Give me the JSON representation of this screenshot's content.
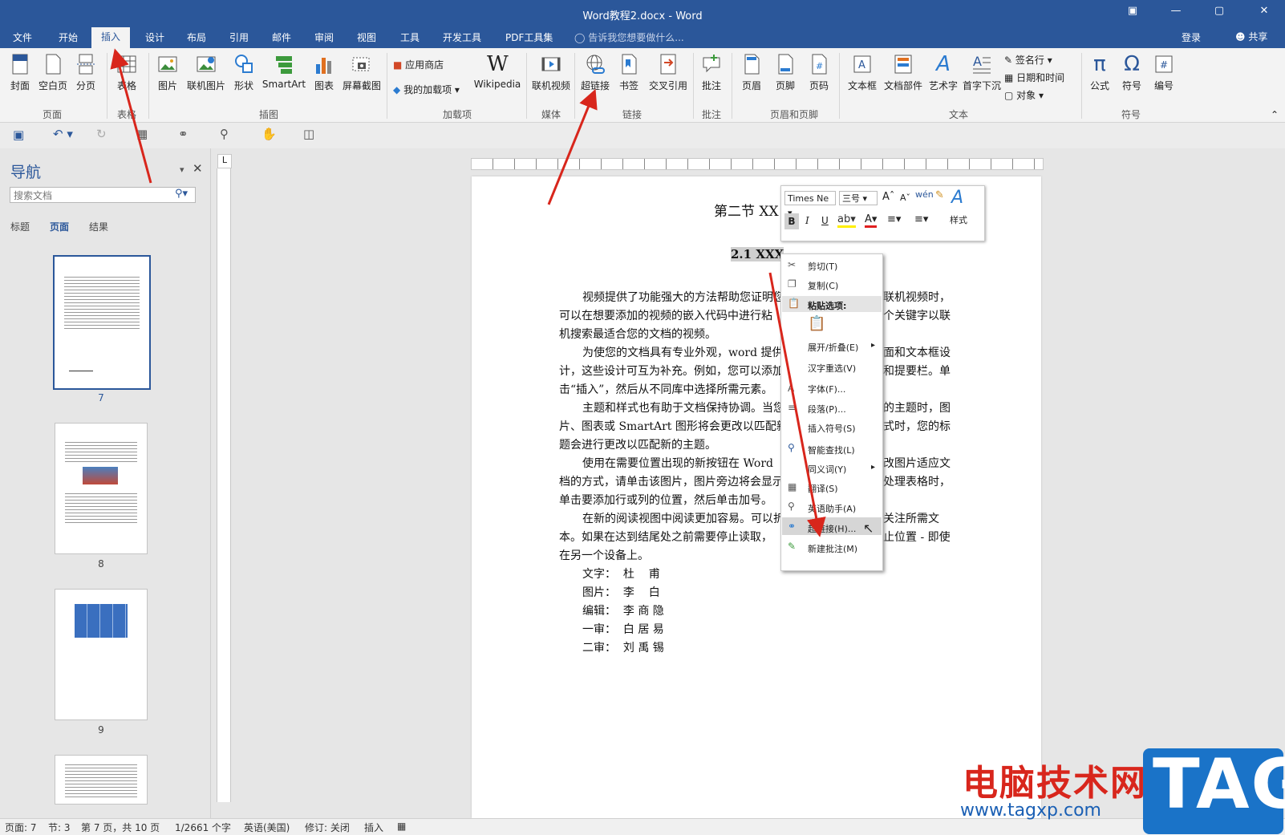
{
  "window": {
    "title": "Word教程2.docx - Word"
  },
  "tabs": [
    "文件",
    "开始",
    "插入",
    "设计",
    "布局",
    "引用",
    "邮件",
    "审阅",
    "视图",
    "工具",
    "开发工具",
    "PDF工具集"
  ],
  "active_tab": "插入",
  "tell_me": "告诉我您想要做什么...",
  "login": "登录",
  "share": "共享",
  "ribbon": {
    "page_group": {
      "label": "页面",
      "items": [
        "封面",
        "空白页",
        "分页"
      ]
    },
    "table_group": {
      "label": "表格",
      "items": [
        "表格"
      ]
    },
    "illus_group": {
      "label": "插图",
      "items": [
        "图片",
        "联机图片",
        "形状",
        "SmartArt",
        "图表",
        "屏幕截图"
      ]
    },
    "addin_group": {
      "label": "加载项",
      "store": "应用商店",
      "myaddin": "我的加载项",
      "wiki": "Wikipedia"
    },
    "media_group": {
      "label": "媒体",
      "items": [
        "联机视频"
      ]
    },
    "link_group": {
      "label": "链接",
      "items": [
        "超链接",
        "书签",
        "交叉引用"
      ]
    },
    "comment_group": {
      "label": "批注",
      "items": [
        "批注"
      ]
    },
    "hf_group": {
      "label": "页眉和页脚",
      "items": [
        "页眉",
        "页脚",
        "页码"
      ]
    },
    "text_group": {
      "label": "文本",
      "items": [
        "文本框",
        "文档部件",
        "艺术字",
        "首字下沉"
      ],
      "small": [
        "签名行",
        "日期和时间",
        "对象"
      ]
    },
    "symbol_group": {
      "label": "符号",
      "items": [
        "公式",
        "符号",
        "编号"
      ]
    }
  },
  "nav": {
    "title": "导航",
    "search_placeholder": "搜索文档",
    "tabs": [
      "标题",
      "页面",
      "结果"
    ],
    "pages": [
      "7",
      "8",
      "9"
    ]
  },
  "doc": {
    "title": "第二节 XX",
    "heading": "2.1 XXX",
    "lines": [
      "视频提供了功能强大的方法帮助您证明您",
      "联机视频时，",
      "可以在想要添加的视频的嵌入代码中进行粘",
      "个关键字以联",
      "机搜索最适合您的文档的视频。",
      "为使您的文档具有专业外观，word 提供",
      "面和文本框设",
      "计，这些设计可互为补充。例如，您可以添加",
      "和提要栏。单",
      "击“插入”，然后从不同库中选择所需元素。",
      "主题和样式也有助于文档保持协调。当您",
      "的主题时，图",
      "片、图表或 SmartArt 图形将会更改以匹配新",
      "式时，您的标",
      "题会进行更改以匹配新的主题。",
      "使用在需要位置出现的新按钮在 Word",
      "改图片适应文",
      "档的方式，请单击该图片，图片旁边将会显示",
      "处理表格时，",
      "单击要添加行或列的位置，然后单击加号。",
      "在新的阅读视图中阅读更加容易。可以折",
      "关注所需文",
      "本。如果在达到结尾处之前需要停止读取，",
      "止位置 - 即使",
      "在另一个设备上。"
    ],
    "credits": [
      "文字：  杜    甫",
      "图片：  李    白",
      "编辑：  李 商 隐",
      "一审：  白 居 易",
      "二审：  刘 禹 锡"
    ]
  },
  "mini_toolbar": {
    "font": "Times Ne",
    "size": "三号",
    "style": "样式",
    "bold": "B",
    "italic": "I",
    "underline": "U"
  },
  "context_menu": [
    "剪切(T)",
    "复制(C)",
    "粘贴选项:",
    "展开/折叠(E)",
    "汉字重选(V)",
    "字体(F)...",
    "段落(P)...",
    "插入符号(S)",
    "智能查找(L)",
    "同义词(Y)",
    "翻译(S)",
    "英语助手(A)",
    "超链接(H)...",
    "新建批注(M)"
  ],
  "status": [
    "页面: 7",
    "节: 3",
    "第 7 页，共 10 页",
    "1/2661 个字",
    "英语(美国)",
    "修订: 关闭",
    "插入"
  ],
  "watermark": {
    "cn": "电脑技术网",
    "url": "www.tagxp.com",
    "tag": "TAG"
  },
  "colors": {
    "accent": "#2b579a",
    "arrow": "#d8261c"
  }
}
